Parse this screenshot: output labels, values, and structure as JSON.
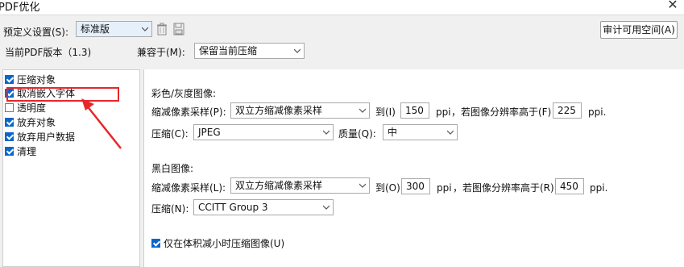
{
  "window": {
    "title": "PDF优化",
    "close_glyph": "✕"
  },
  "top": {
    "preset_label": "预定义设置(S):",
    "preset_value": "标准版",
    "audit_button": "审计可用空间(A)",
    "pdf_version_label": "当前PDF版本（1.3)",
    "compat_label": "兼容于(M):",
    "compat_value": "保留当前压缩"
  },
  "sidebar": {
    "items": [
      {
        "label": "压缩对象",
        "checked": true
      },
      {
        "label": "取消嵌入字体",
        "checked": true
      },
      {
        "label": "透明度",
        "checked": false
      },
      {
        "label": "放弃对象",
        "checked": true
      },
      {
        "label": "放弃用户数据",
        "checked": true
      },
      {
        "label": "清理",
        "checked": true
      }
    ]
  },
  "color_image": {
    "heading": "彩色/灰度图像:",
    "downsample_label": "缩减像素采样(P):",
    "downsample_value": "双立方缩减像素采样",
    "to_label": "到(I)",
    "to_value": "150",
    "ppi": "ppi",
    "threshold_label": "，若图像分辨率高于(F)",
    "threshold_value": "225",
    "ppi_dot": "ppi.",
    "compression_label": "压缩(C):",
    "compression_value": "JPEG",
    "quality_label": "质量(Q):",
    "quality_value": "中"
  },
  "bw_image": {
    "heading": "黑白图像:",
    "downsample_label": "缩减像素采样(L):",
    "downsample_value": "双立方缩减像素采样",
    "to_label": "到(O)",
    "to_value": "300",
    "ppi": "ppi",
    "threshold_label": "，若图像分辨率高于(R)",
    "threshold_value": "450",
    "ppi_dot": "ppi.",
    "compression_label": "压缩(N):",
    "compression_value": "CCITT Group 3"
  },
  "only_smaller": {
    "label": "仅在体积减小时压缩图像(U)",
    "checked": true
  },
  "colors": {
    "accent": "#0a67c8",
    "highlight": "#e8262a"
  }
}
